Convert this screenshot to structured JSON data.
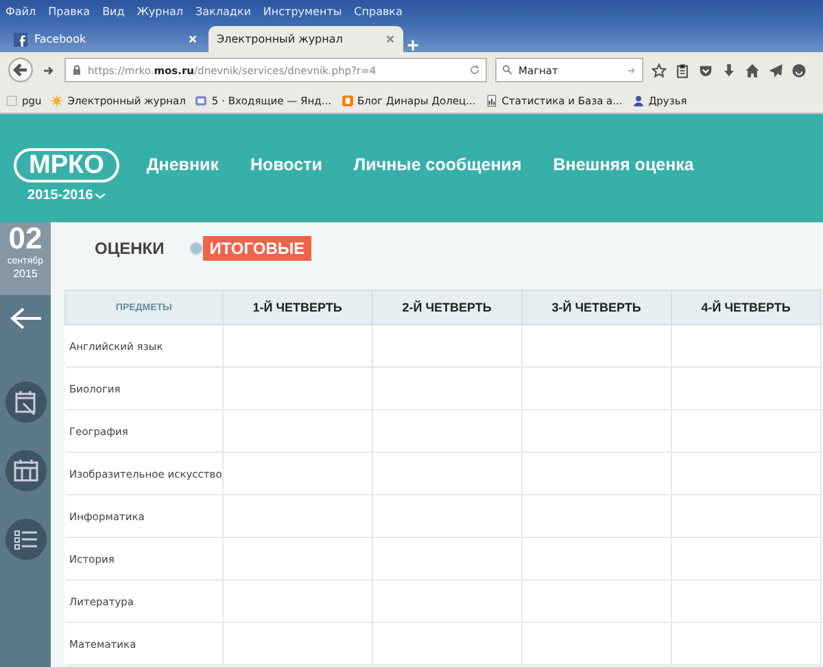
{
  "menu_bar": [
    "Файл",
    "Правка",
    "Вид",
    "Журнал",
    "Закладки",
    "Инструменты",
    "Справка"
  ],
  "tabs": [
    {
      "title": "Facebook",
      "selected": false
    },
    {
      "title": "Электронный журнал",
      "selected": true
    }
  ],
  "address_bar": {
    "url_start": "https://mrko.",
    "url_domain": "mos.ru",
    "url_rest": "/dnevnik/services/dnevnik.php?r=4"
  },
  "search": {
    "value": "Магнат"
  },
  "bookmarks": [
    "pgu",
    "Электронный журнал",
    "5 · Входящие — Янд...",
    "Блог Динары Долец...",
    "Статистика и База а...",
    "Друзья"
  ],
  "site": {
    "logo": "МРКО",
    "year": "2015-2016",
    "nav": [
      "Дневник",
      "Новости",
      "Личные сообщения",
      "Внешняя оценка"
    ]
  },
  "date": {
    "day": "02",
    "month": "сентябр",
    "year": "2015"
  },
  "grade_tabs": [
    {
      "label": "ОЦЕНКИ",
      "selected": false
    },
    {
      "label": "ИТОГОВЫЕ",
      "selected": true
    }
  ],
  "table": {
    "columns": [
      "ПРЕДМЕТЫ",
      "1-Й ЧЕТВЕРТЬ",
      "2-Й ЧЕТВЕРТЬ",
      "3-Й ЧЕТВЕРТЬ",
      "4-Й ЧЕТВЕРТЬ"
    ],
    "rows": [
      "Английский язык",
      "Биология",
      "География",
      "Изобразительное искусство",
      "Информатика",
      "История",
      "Литература",
      "Математика"
    ]
  }
}
